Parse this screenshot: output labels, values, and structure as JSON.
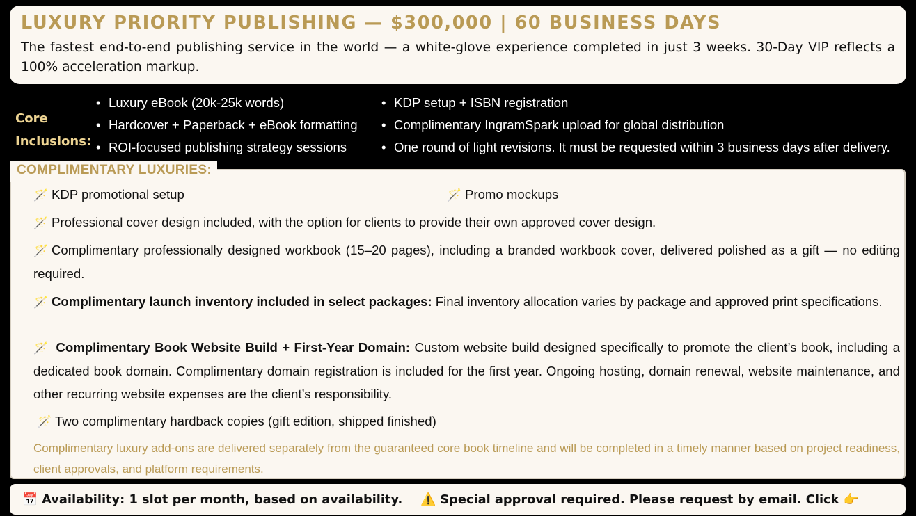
{
  "header": {
    "title": "LUXURY PRIORITY PUBLISHING — $300,000 | 60 BUSINESS DAYS",
    "description": "The fastest end-to-end publishing service in the world — a white-glove experience completed in just 3 weeks. 30-Day VIP reflects a 100% acceleration markup."
  },
  "core": {
    "label_line1": "Core",
    "label_line2": "Inclusions:",
    "left_items": [
      "Luxury eBook (20k-25k words)",
      "Hardcover + Paperback + eBook formatting",
      "ROI-focused publishing strategy sessions"
    ],
    "right_items": [
      "KDP setup + ISBN registration",
      "Complimentary IngramSpark upload for global distribution",
      "One round of light revisions. It must be requested within 3 business days after delivery."
    ]
  },
  "luxuries": {
    "title": "COMPLIMENTARY LUXURIES:",
    "icon": "magic-wand-icon",
    "wand_glyph": "🪄",
    "kdp_promo": "KDP promotional setup",
    "promo_mockups": "Promo mockups",
    "cover_design": "Professional cover design included, with the option for clients to provide their own approved cover design.",
    "workbook": "Complimentary professionally designed workbook (15–20 pages), including a branded workbook cover, delivered polished as a gift — no editing required.",
    "inventory_heading": "Complimentary launch inventory included in select packages:",
    "inventory_text": "Final inventory allocation varies by package and approved print specifications.",
    "website_heading": "Complimentary Book Website Build + First-Year Domain:",
    "website_text": "Custom website build designed specifically to promote the client’s book, including a dedicated book domain. Complimentary domain registration is included for the first year. Ongoing hosting, domain renewal, website maintenance, and other recurring website expenses are the client’s responsibility.",
    "hardback": "Two complimentary hardback copies (gift edition, shipped finished)",
    "note": "Complimentary luxury add-ons are delivered separately from the guaranteed core book timeline and will be completed in a timely manner based on project readiness, client approvals, and platform requirements."
  },
  "footer": {
    "calendar_glyph": "📅",
    "availability": "Availability: 1 slot per month, based on availability.",
    "warning_glyph": "⚠️",
    "approval": "Special approval required. Please request by email. Click",
    "pointer_glyph": "👉"
  },
  "colors": {
    "gold": "#b99a55",
    "light_gold": "#ecd392",
    "cream": "#fbf7f1",
    "background": "#000000"
  }
}
